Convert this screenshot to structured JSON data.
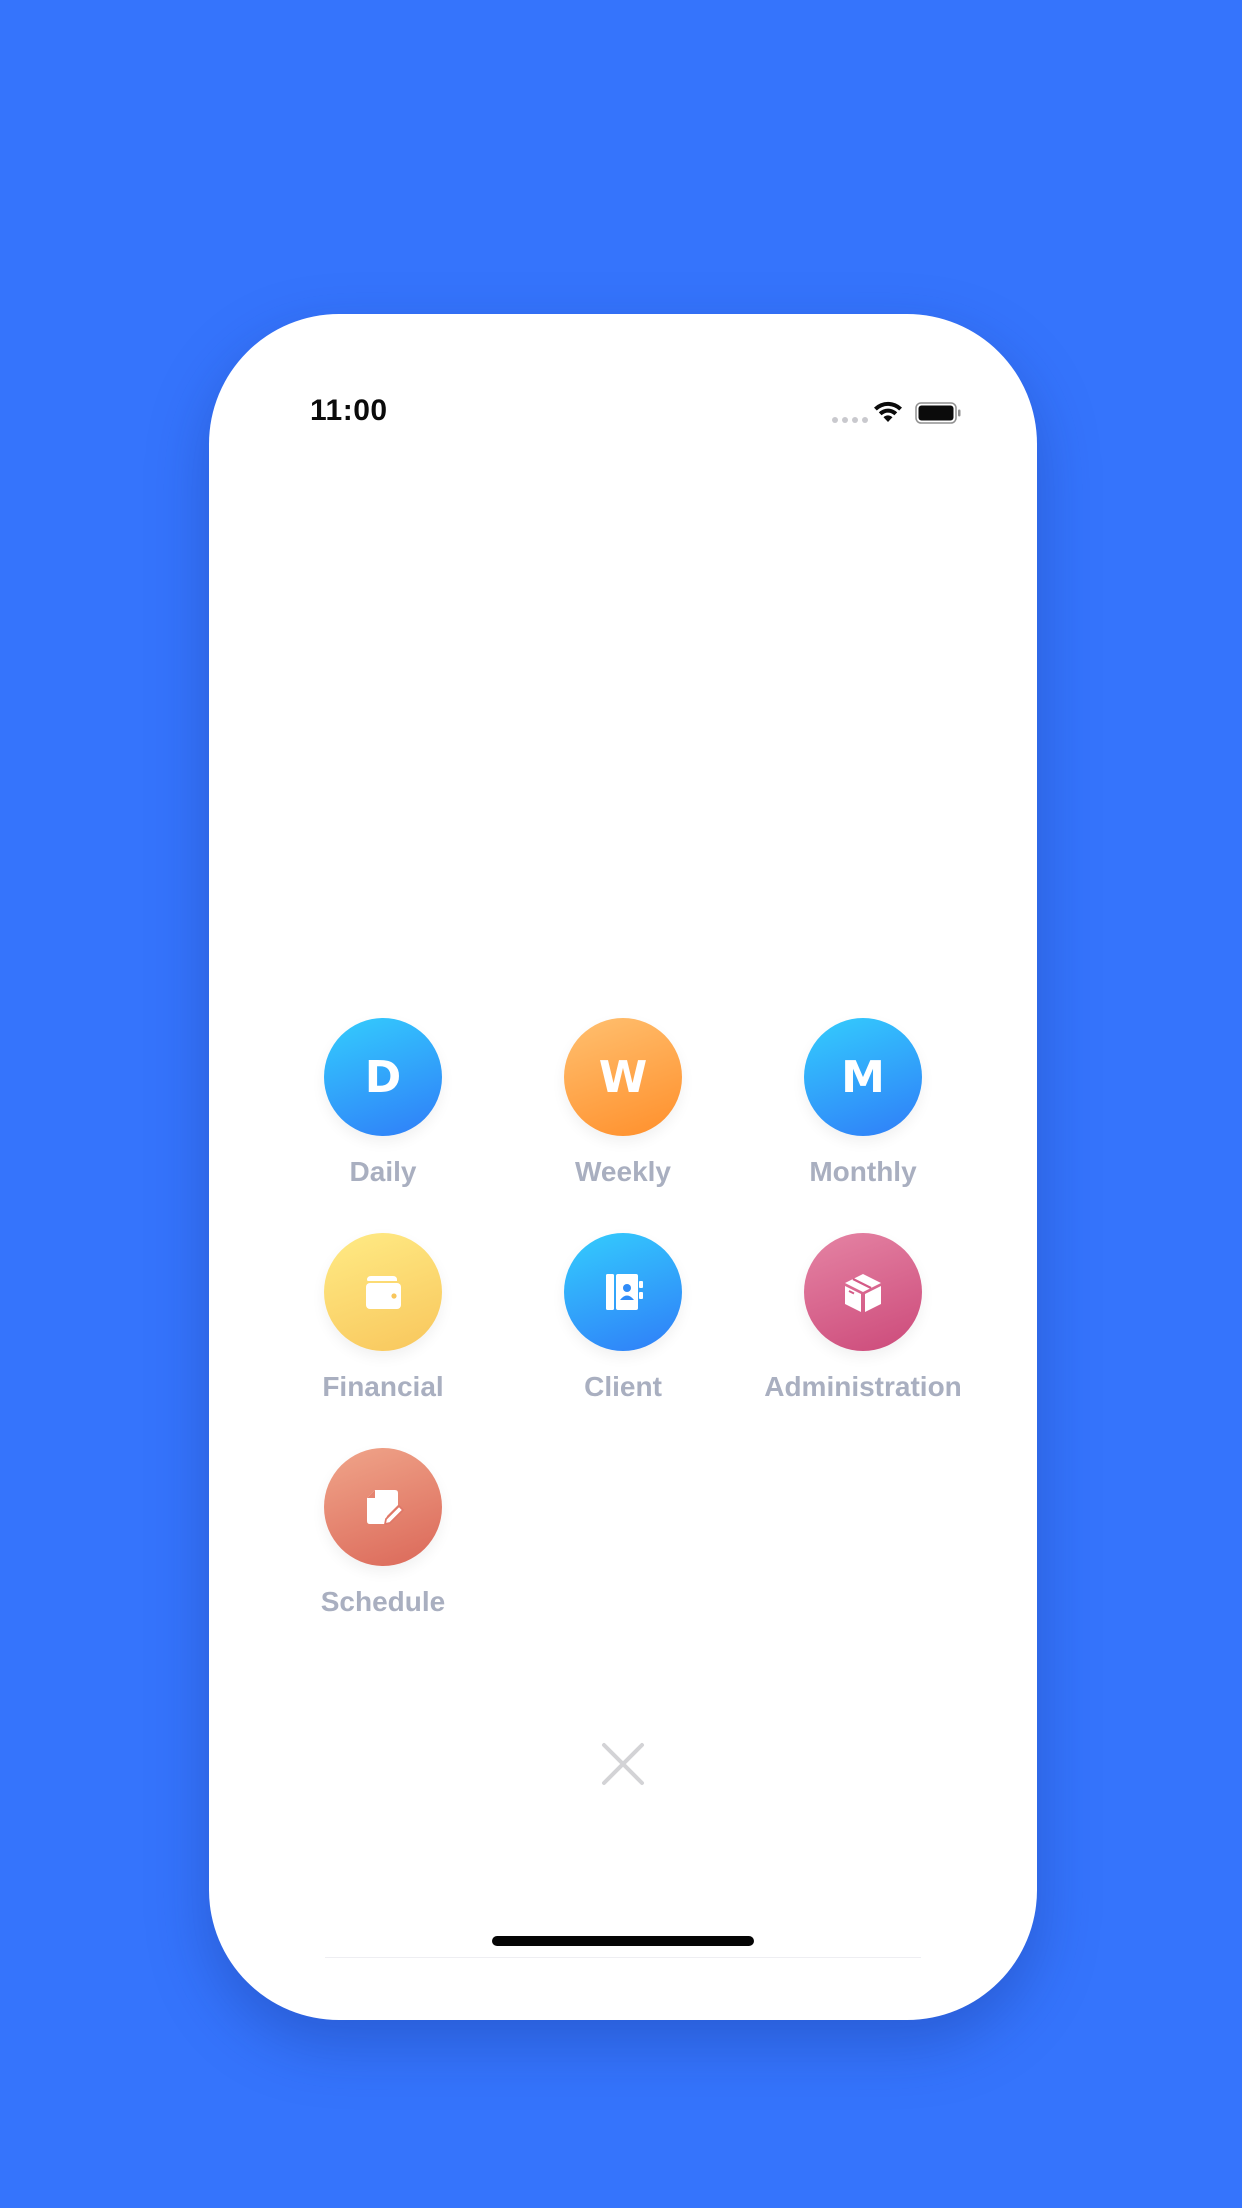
{
  "status_bar": {
    "time": "11:00",
    "icons": [
      "signal-dots-icon",
      "wifi-icon",
      "battery-icon"
    ]
  },
  "menu": {
    "items": [
      {
        "label": "Daily",
        "glyph": "D",
        "icon": "letter-d-icon",
        "gradient": [
          "#34CDFD",
          "#2F7DF8"
        ]
      },
      {
        "label": "Weekly",
        "glyph": "W",
        "icon": "letter-w-icon",
        "gradient": [
          "#FFC070",
          "#FF8F2B"
        ]
      },
      {
        "label": "Monthly",
        "glyph": "M",
        "icon": "letter-m-icon",
        "gradient": [
          "#34CDFD",
          "#2F7DF8"
        ]
      },
      {
        "label": "Financial",
        "glyph": "",
        "icon": "wallet-icon",
        "gradient": [
          "#FFEB85",
          "#F8C65C"
        ]
      },
      {
        "label": "Client",
        "glyph": "",
        "icon": "contact-book-icon",
        "gradient": [
          "#34CDFD",
          "#2F7DF8"
        ]
      },
      {
        "label": "Administration",
        "glyph": "",
        "icon": "box-icon",
        "gradient": [
          "#E584A4",
          "#CC4A7A"
        ]
      },
      {
        "label": "Schedule",
        "glyph": "",
        "icon": "edit-document-icon",
        "gradient": [
          "#F0A58A",
          "#DB6859"
        ]
      }
    ]
  },
  "close": {
    "icon": "close-icon"
  },
  "colors": {
    "background": "#3574FC",
    "label": "#A9AFC0",
    "close_icon": "#D3D3D6"
  }
}
